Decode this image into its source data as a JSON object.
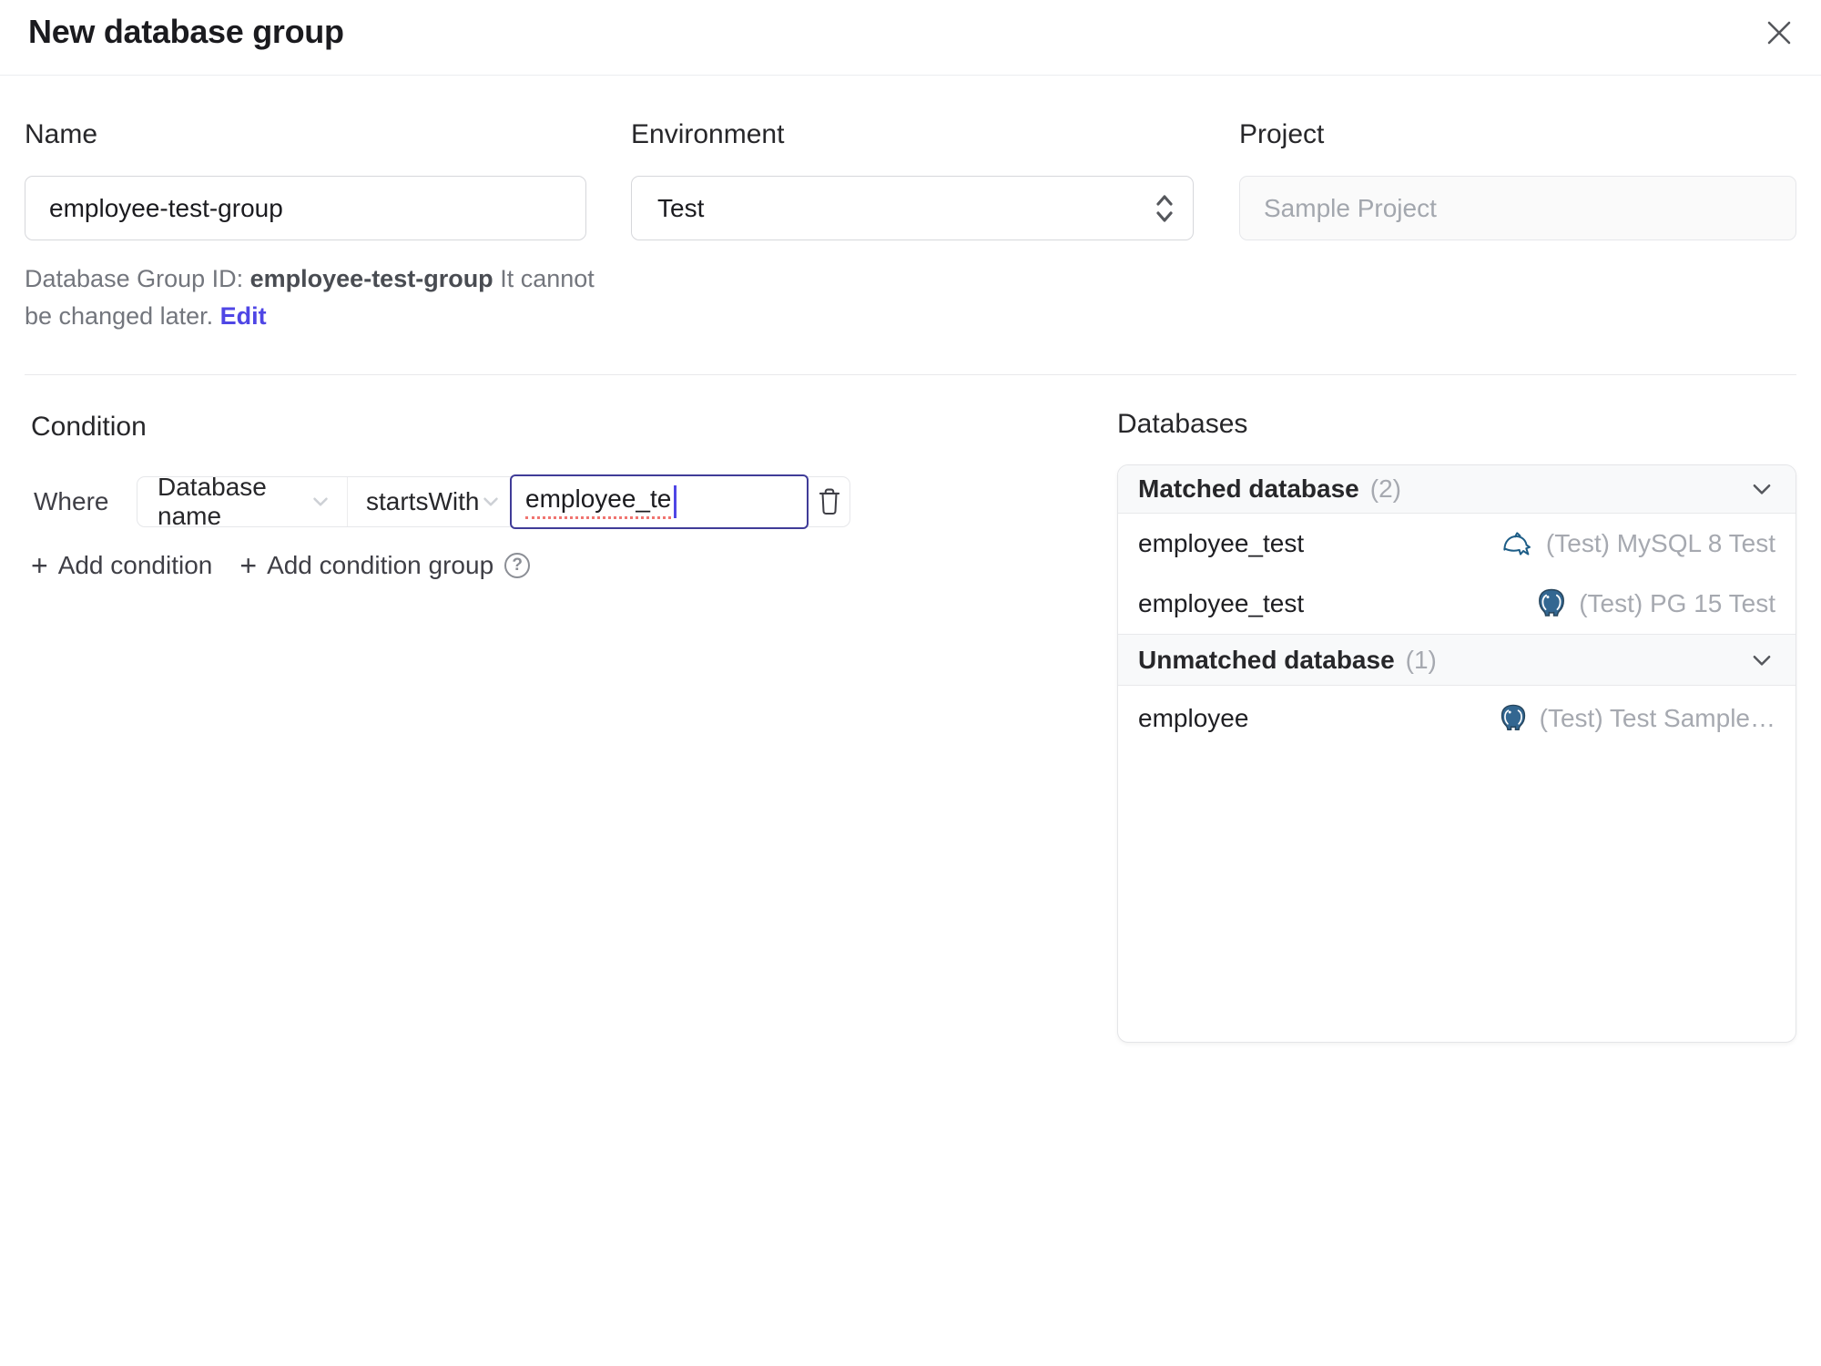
{
  "dialog": {
    "title": "New database group"
  },
  "form": {
    "name": {
      "label": "Name",
      "value": "employee-test-group"
    },
    "environment": {
      "label": "Environment",
      "value": "Test"
    },
    "project": {
      "label": "Project",
      "value": "Sample Project"
    },
    "id_help": {
      "prefix": "Database Group ID: ",
      "id": "employee-test-group",
      "suffix": " It cannot be changed later. ",
      "edit": "Edit"
    }
  },
  "condition": {
    "heading": "Condition",
    "where": "Where",
    "field": "Database name",
    "operator": "startsWith",
    "value": "employee_te",
    "plus": "+",
    "add_condition": "Add condition",
    "add_condition_group": "Add condition group",
    "help": "?"
  },
  "databases": {
    "heading": "Databases",
    "matched": {
      "title": "Matched database",
      "count": "(2)"
    },
    "matched_rows": [
      {
        "name": "employee_test",
        "instance": "(Test) MySQL 8 Test",
        "engine": "mysql"
      },
      {
        "name": "employee_test",
        "instance": "(Test) PG 15 Test",
        "engine": "postgres"
      }
    ],
    "unmatched": {
      "title": "Unmatched database",
      "count": "(1)"
    },
    "unmatched_rows": [
      {
        "name": "employee",
        "instance": "(Test) Test Sample…",
        "engine": "postgres"
      }
    ]
  },
  "colors": {
    "accent_indigo": "#4f46e5",
    "focus_border": "#403c98",
    "spellcheck_red": "#f07470",
    "mysql_blue": "#1d5d87",
    "postgres_blue": "#336791",
    "header_bg": "#f8f9fa"
  }
}
